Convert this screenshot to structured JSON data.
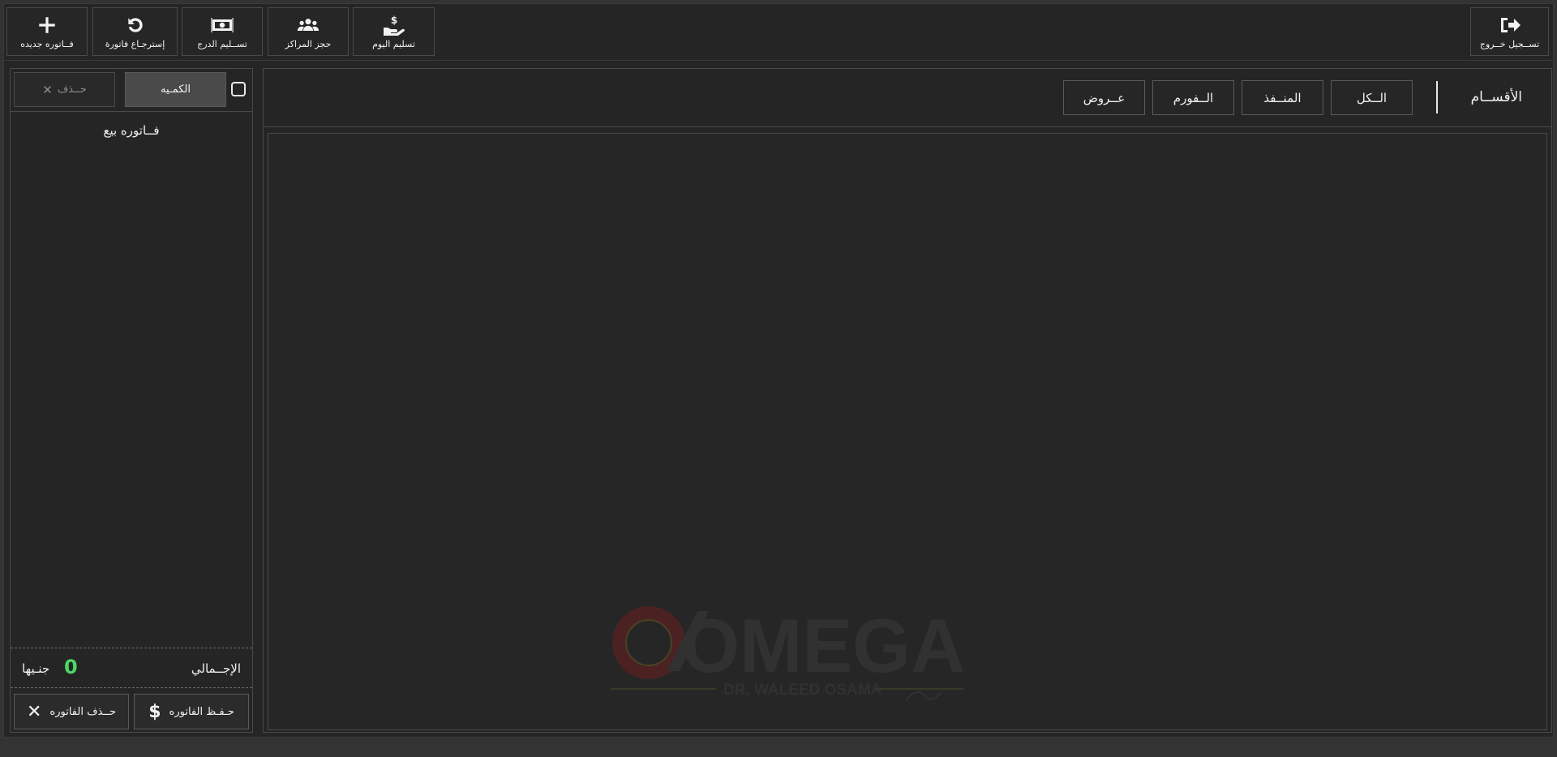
{
  "toolbar": {
    "buttons": [
      {
        "label": "فــاتوره جديده",
        "icon": "plus-icon"
      },
      {
        "label": "إسترجـاع فاتورة",
        "icon": "undo-icon"
      },
      {
        "label": "تســليم الدرج",
        "icon": "money-bill-icon"
      },
      {
        "label": "حجز المراكز",
        "icon": "users-icon"
      },
      {
        "label": "تسليم اليوم",
        "icon": "hand-dollar-icon"
      }
    ],
    "logout_label": "تســجيل خــروج"
  },
  "cart": {
    "delete_header": "حــذف",
    "quantity_header": "الكمـيه",
    "title": "فــاتوره بيع",
    "total_label": "الإجــمالي",
    "total_value": "0",
    "currency": "جنـيها",
    "save_button": "حـفـظ الفاتوره",
    "delete_button": "حــذف الفاتوره"
  },
  "categories": {
    "title": "الأقســام",
    "items": [
      "الــكل",
      "المنــفذ",
      "الــفورم",
      "عــروض"
    ]
  },
  "watermark": {
    "brand": "OMEGA",
    "subtitle": "DR. WALEED OSAMA"
  },
  "colors": {
    "background": "#252525",
    "accent_total": "#4cd964",
    "logo_red": "#7a1c1c",
    "logo_gray": "#3a3a3a"
  }
}
